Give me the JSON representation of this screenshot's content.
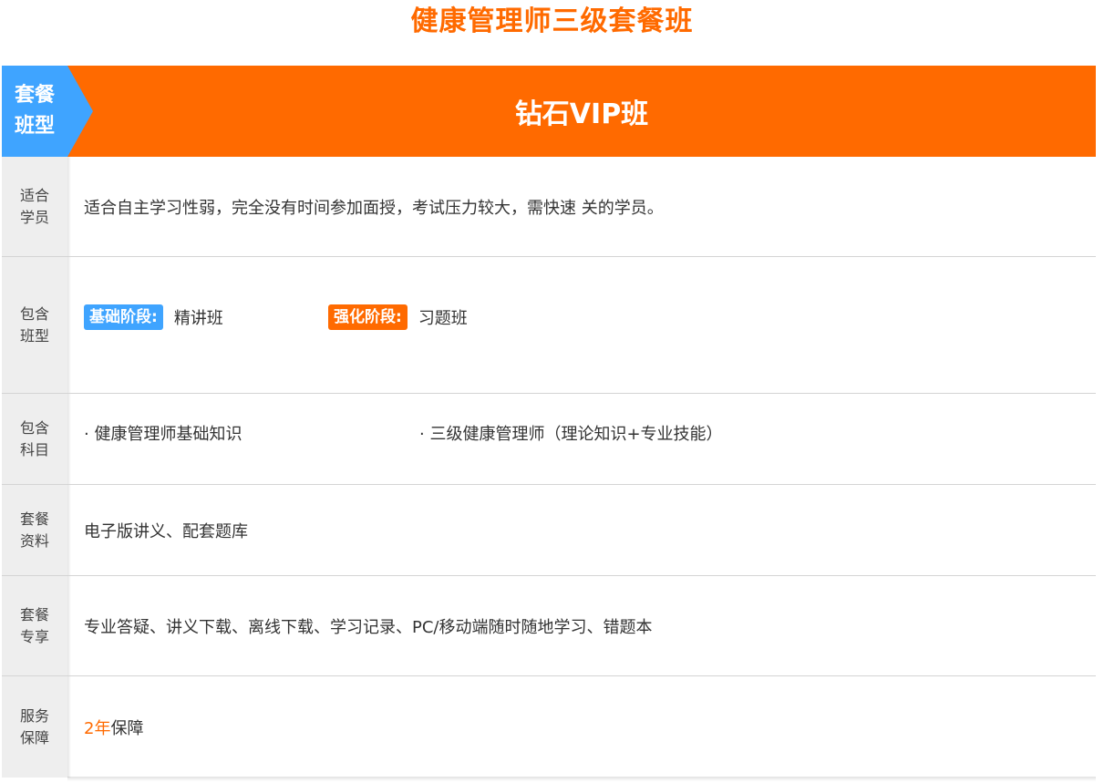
{
  "page_title": "健康管理师三级套餐班",
  "header": {
    "label_line1": "套餐",
    "label_line2": "班型",
    "plan_name": "钻石VIP班"
  },
  "rows": {
    "students": {
      "label_line1": "适合",
      "label_line2": "学员",
      "text": "适合自主学习性弱，完全没有时间参加面授，考试压力较大，需快速 关的学员。"
    },
    "classes": {
      "label_line1": "包含",
      "label_line2": "班型",
      "stage1_tag": "基础阶段:",
      "stage1_value": "精讲班",
      "stage2_tag": "强化阶段:",
      "stage2_value": "习题班"
    },
    "subjects": {
      "label_line1": "包含",
      "label_line2": "科目",
      "subject1": "· 健康管理师基础知识",
      "subject2": "· 三级健康管理师（理论知识+专业技能）"
    },
    "materials": {
      "label_line1": "套餐",
      "label_line2": "资料",
      "text": "电子版讲义、配套题库"
    },
    "benefits": {
      "label_line1": "套餐",
      "label_line2": "专享",
      "text": "专业答疑、讲义下载、离线下载、学习记录、PC/移动端随时随地学习、错题本"
    },
    "service": {
      "label_line1": "服务",
      "label_line2": "保障",
      "highlight": "2年",
      "text": "保障"
    }
  },
  "colors": {
    "orange": "#ff6a00",
    "blue": "#3fa4ff",
    "label_bg": "#eeeeee"
  }
}
